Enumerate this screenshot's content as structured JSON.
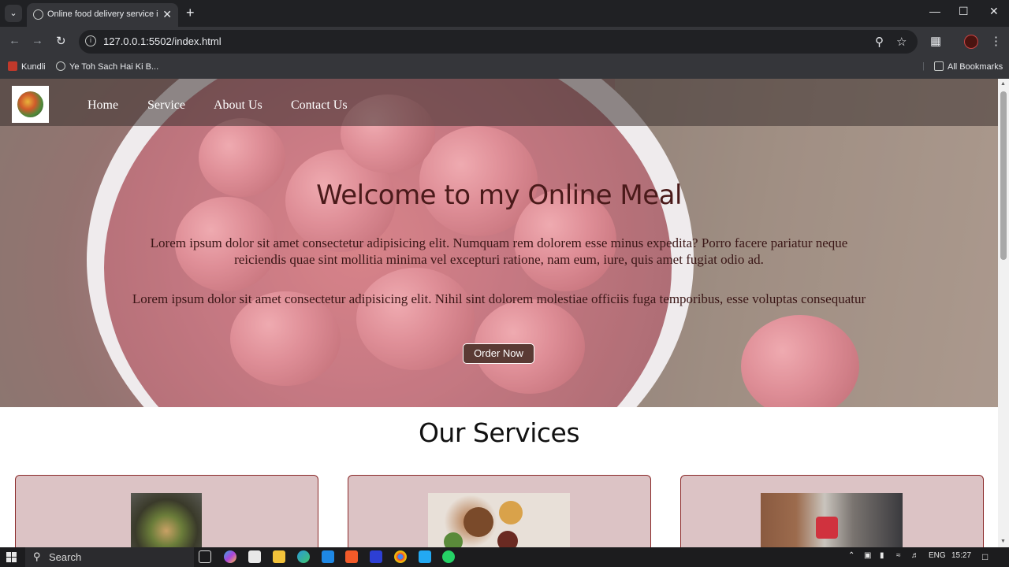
{
  "browser": {
    "tab_title": "Online food delivery service in",
    "url": "127.0.0.1:5502/index.html",
    "bookmarks": [
      {
        "label": "Kundli"
      },
      {
        "label": "Ye Toh Sach Hai Ki B..."
      }
    ],
    "all_bookmarks_label": "All Bookmarks"
  },
  "site": {
    "nav": [
      "Home",
      "Service",
      "About Us",
      "Contact Us"
    ],
    "hero": {
      "title": "Welcome to my Online Meal",
      "paragraph1": "Lorem ipsum dolor sit amet consectetur adipisicing elit. Numquam rem dolorem esse minus expedita? Porro facere pariatur neque reiciendis quae sint mollitia minima vel excepturi ratione, nam eum, iure, quis amet fugiat odio ad.",
      "paragraph2": "Lorem ipsum dolor sit amet consectetur adipisicing elit. Nihil sint dolorem molestiae officiis fuga temporibus, esse voluptas consequatur",
      "button": "Order Now"
    },
    "services_title": "Our Services"
  },
  "taskbar": {
    "search_label": "Search",
    "language": "ENG",
    "time": "15:27"
  },
  "colors": {
    "hero_title": "#4a1a1a",
    "order_button": "#5a3a34",
    "card_bg": "#dcc3c5",
    "card_border": "#8b2a2a"
  }
}
